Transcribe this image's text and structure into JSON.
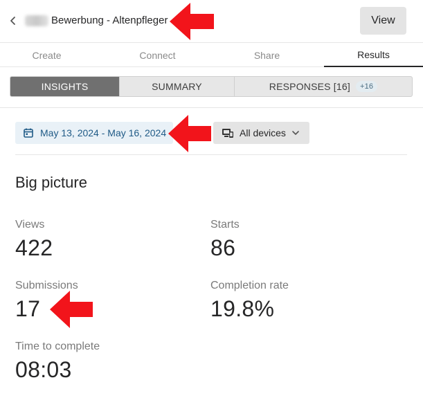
{
  "header": {
    "title": "Bewerbung - Altenpfleger",
    "view_label": "View"
  },
  "tabs": [
    {
      "label": "Create"
    },
    {
      "label": "Connect"
    },
    {
      "label": "Share"
    },
    {
      "label": "Results"
    }
  ],
  "segments": {
    "insights": "INSIGHTS",
    "summary": "SUMMARY",
    "responses": "RESPONSES [16]",
    "responses_badge": "+16"
  },
  "filters": {
    "date_range": "May 13, 2024 - May 16, 2024",
    "devices": "All devices"
  },
  "big_picture": {
    "title": "Big picture",
    "views_label": "Views",
    "views_value": "422",
    "starts_label": "Starts",
    "starts_value": "86",
    "submissions_label": "Submissions",
    "submissions_value": "17",
    "completion_label": "Completion rate",
    "completion_value": "19.8%",
    "time_label": "Time to complete",
    "time_value": "08:03"
  },
  "colors": {
    "accent_blue": "#1f5a86",
    "active_segment": "#707070",
    "annotation_red": "#f2141b"
  },
  "icons": {
    "back": "chevron-left-icon",
    "calendar": "calendar-icon",
    "devices": "devices-icon",
    "dropdown": "chevron-down-icon",
    "annotation": "red-arrow-icon"
  }
}
